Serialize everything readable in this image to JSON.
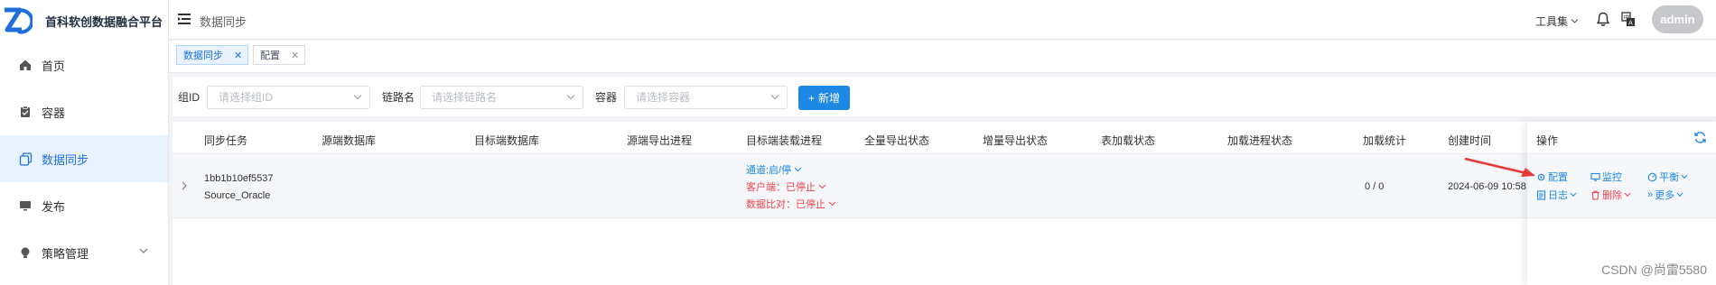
{
  "app": {
    "title": "首科软创数据融合平台",
    "logo_icon": "zd-logo"
  },
  "sidebar": {
    "items": [
      {
        "label": "首页",
        "icon": "home-icon"
      },
      {
        "label": "容器",
        "icon": "clipboard-icon"
      },
      {
        "label": "数据同步",
        "icon": "copy-icon",
        "active": true
      },
      {
        "label": "发布",
        "icon": "monitor-icon"
      },
      {
        "label": "策略管理",
        "icon": "bulb-icon",
        "expandable": true
      }
    ]
  },
  "header": {
    "breadcrumb": "数据同步",
    "toolset": "工具集",
    "user": "admin"
  },
  "tags": [
    {
      "label": "数据同步",
      "active": true
    },
    {
      "label": "配置",
      "active": false
    }
  ],
  "filters": {
    "group_label": "组ID",
    "group_placeholder": "请选择组ID",
    "link_label": "链路名",
    "link_placeholder": "请选择链路名",
    "container_label": "容器",
    "container_placeholder": "请选择容器",
    "add_button": "新增"
  },
  "table": {
    "columns": [
      "同步任务",
      "源端数据库",
      "目标端数据库",
      "源端导出进程",
      "目标端装载进程",
      "全量导出状态",
      "增量导出状态",
      "表加载状态",
      "加载进程状态",
      "加载统计",
      "创建时间"
    ],
    "rows": [
      {
        "task_id": "1bb1b10ef5537",
        "task_name": "Source_Oracle",
        "channel": "通道:启/停",
        "client": "客户端：已停止",
        "compare": "数据比对：已停止",
        "load_stats": "0 / 0",
        "created": "2024-06-09 10:58:"
      }
    ]
  },
  "ops": {
    "header": "操作",
    "config": "配置",
    "monitor": "监控",
    "balance": "平衡",
    "log": "日志",
    "delete": "删除",
    "more": "更多"
  },
  "watermark": "CSDN @尚雷5580",
  "colors": {
    "primary": "#1e88e5",
    "danger": "#f0434b",
    "active_bg": "#e8f3ff"
  }
}
